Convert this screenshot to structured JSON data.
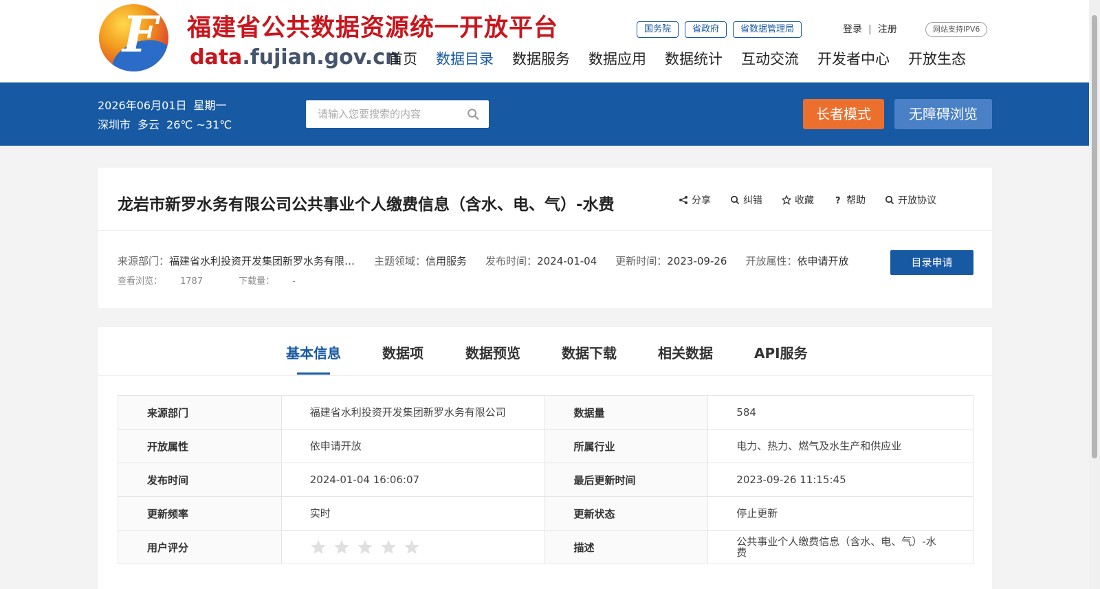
{
  "header": {
    "site_title": "福建省公共数据资源统一开放平台",
    "domain_prefix": "data",
    "domain_rest": ".fujian.gov.cn",
    "top_links": [
      "国务院",
      "省政府",
      "省数据管理局"
    ],
    "login": "登录",
    "separator": "|",
    "register": "注册",
    "ipv6_badge": "网站支持IPV6",
    "nav": [
      {
        "label": "首页",
        "active": false
      },
      {
        "label": "数据目录",
        "active": true
      },
      {
        "label": "数据服务",
        "active": false
      },
      {
        "label": "数据应用",
        "active": false
      },
      {
        "label": "数据统计",
        "active": false
      },
      {
        "label": "互动交流",
        "active": false
      },
      {
        "label": "开发者中心",
        "active": false
      },
      {
        "label": "开放生态",
        "active": false
      }
    ]
  },
  "band": {
    "date": "2026年06月01日",
    "weekday": "星期一",
    "city": "深圳市",
    "weather": "多云",
    "temperature": "26℃ ~31℃",
    "search_placeholder": "请输入您要搜索的内容",
    "elder_mode": "长者模式",
    "accessibility": "无障碍浏览"
  },
  "dataset": {
    "title": "龙岩市新罗水务有限公司公共事业个人缴费信息（含水、电、气）-水费",
    "tools": [
      {
        "label": "分享",
        "icon": "share-icon"
      },
      {
        "label": "纠错",
        "icon": "search-icon"
      },
      {
        "label": "收藏",
        "icon": "star-icon"
      },
      {
        "label": "帮助",
        "icon": "question-icon"
      },
      {
        "label": "开放协议",
        "icon": "search-icon"
      }
    ],
    "meta": {
      "source_label": "来源部门：",
      "source_value": "福建省水利投资开发集团新罗水务有限公司",
      "topic_label": "主题领域：",
      "topic_value": "信用服务",
      "publish_label": "发布时间：",
      "publish_value": "2024-01-04",
      "update_label": "更新时间：",
      "update_value": "2023-09-26",
      "open_label": "开放属性：",
      "open_value": "依申请开放"
    },
    "views_label": "查看浏览：",
    "views": "1787",
    "downloads_label": "下载量：",
    "downloads": "-",
    "apply_button": "目录申请"
  },
  "tabs": [
    {
      "label": "基本信息",
      "active": true
    },
    {
      "label": "数据项",
      "active": false
    },
    {
      "label": "数据预览",
      "active": false
    },
    {
      "label": "数据下载",
      "active": false
    },
    {
      "label": "相关数据",
      "active": false
    },
    {
      "label": "API服务",
      "active": false
    }
  ],
  "info_table": [
    {
      "k1": "来源部门",
      "v1": "福建省水利投资开发集团新罗水务有限公司",
      "k2": "数据量",
      "v2": "584"
    },
    {
      "k1": "开放属性",
      "v1": "依申请开放",
      "k2": "所属行业",
      "v2": "电力、热力、燃气及水生产和供应业"
    },
    {
      "k1": "发布时间",
      "v1": "2024-01-04 16:06:07",
      "k2": "最后更新时间",
      "v2": "2023-09-26 11:15:45"
    },
    {
      "k1": "更新频率",
      "v1": "实时",
      "k2": "更新状态",
      "v2": "停止更新"
    },
    {
      "k1": "用户评分",
      "v1": "",
      "k2": "描述",
      "v2": "公共事业个人缴费信息（含水、电、气）-水费"
    }
  ],
  "rating": {
    "value": 0,
    "max": 5
  },
  "colors": {
    "primary": "#1759a3",
    "orange": "#ec6f2e",
    "brand_red": "#c8161d"
  }
}
